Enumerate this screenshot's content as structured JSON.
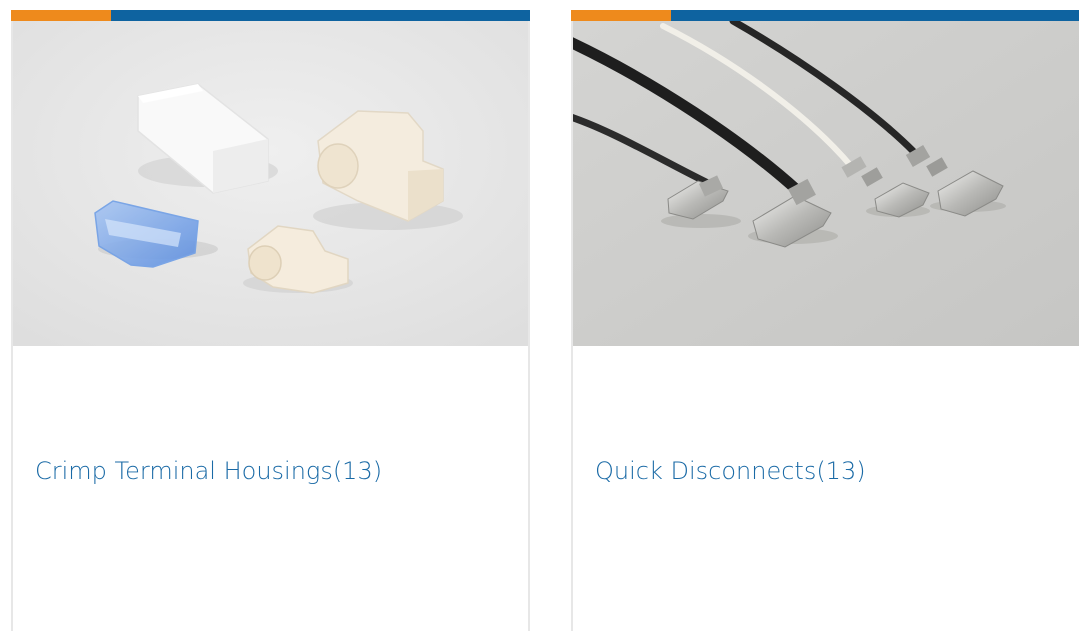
{
  "theme": {
    "accent_orange": "#ee8a1c",
    "accent_blue": "#0e63a0",
    "title_color": "#1a6aa6",
    "card_border": "#e7e7e7"
  },
  "cards": [
    {
      "title": "Crimp Terminal Housings(13)",
      "image_icon": "crimp-terminal-housings-photo"
    },
    {
      "title": "Quick Disconnects(13)",
      "image_icon": "quick-disconnects-photo"
    }
  ]
}
